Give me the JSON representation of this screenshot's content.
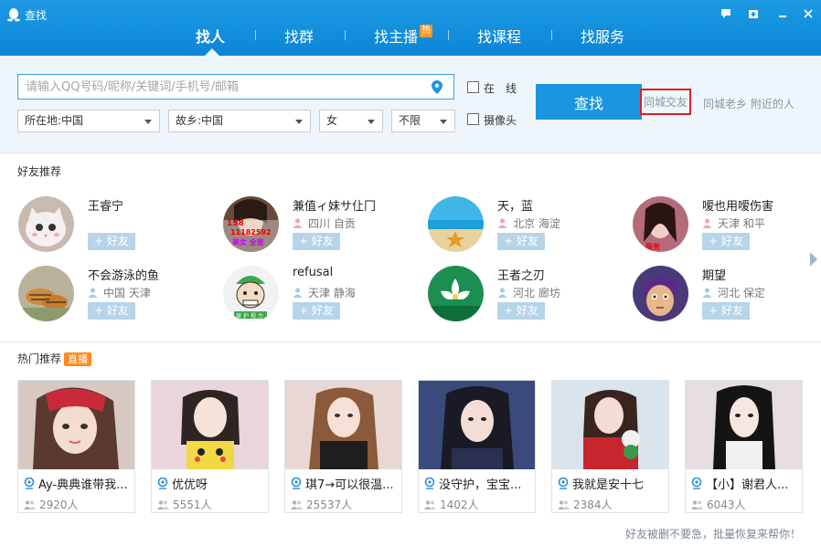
{
  "window": {
    "title": "查找"
  },
  "nav": {
    "tabs": [
      {
        "label": "找人"
      },
      {
        "label": "找群"
      },
      {
        "label": "找主播",
        "badge": "热"
      },
      {
        "label": "找课程"
      },
      {
        "label": "找服务"
      }
    ]
  },
  "search": {
    "placeholder": "请输入QQ号码/昵称/关键词/手机号/邮箱",
    "value": "",
    "location": "所在地:中国",
    "hometown": "故乡:中国",
    "gender": "女",
    "age": "不限",
    "online_label": "在　线",
    "camera_label": "摄像头",
    "button": "查找",
    "links": [
      "同城交友",
      "同城老乡",
      "附近的人"
    ]
  },
  "friends": {
    "title": "好友推荐",
    "add_label": "+ 好友",
    "items": [
      {
        "name": "王睿宁",
        "location": ""
      },
      {
        "name": "兼值ィ妹サ仩冂",
        "location": "四川 自贡"
      },
      {
        "name": "天，蓝",
        "location": "北京 海淀"
      },
      {
        "name": "嗳也用嗳伤害",
        "location": "天津 和平"
      },
      {
        "name": "不会游泳的鱼",
        "location": "中国 天津"
      },
      {
        "name": "refusal",
        "location": "天津 静海"
      },
      {
        "name": "王者之刃",
        "location": "河北 廊坊"
      },
      {
        "name": "期望",
        "location": "河北 保定"
      }
    ]
  },
  "hot": {
    "title": "热门推荐",
    "badge": "直播",
    "items": [
      {
        "title": "Ay-典典谁带我...",
        "count": "2920人"
      },
      {
        "title": "优优呀",
        "count": "5551人"
      },
      {
        "title": "琪7→可以很温...",
        "count": "25537人"
      },
      {
        "title": "没守护，宝宝...",
        "count": "1402人"
      },
      {
        "title": "我就是安十七",
        "count": "2384人"
      },
      {
        "title": "【小】谢君人...",
        "count": "6043人"
      }
    ]
  },
  "footer": {
    "text": "好友被删不要急，批量恢复来帮你！"
  },
  "colors": {
    "titlebar": "#1a96e0",
    "accent": "#1a96e0",
    "highlight_box": "#e02020",
    "live_badge": "#ff8a1f"
  }
}
